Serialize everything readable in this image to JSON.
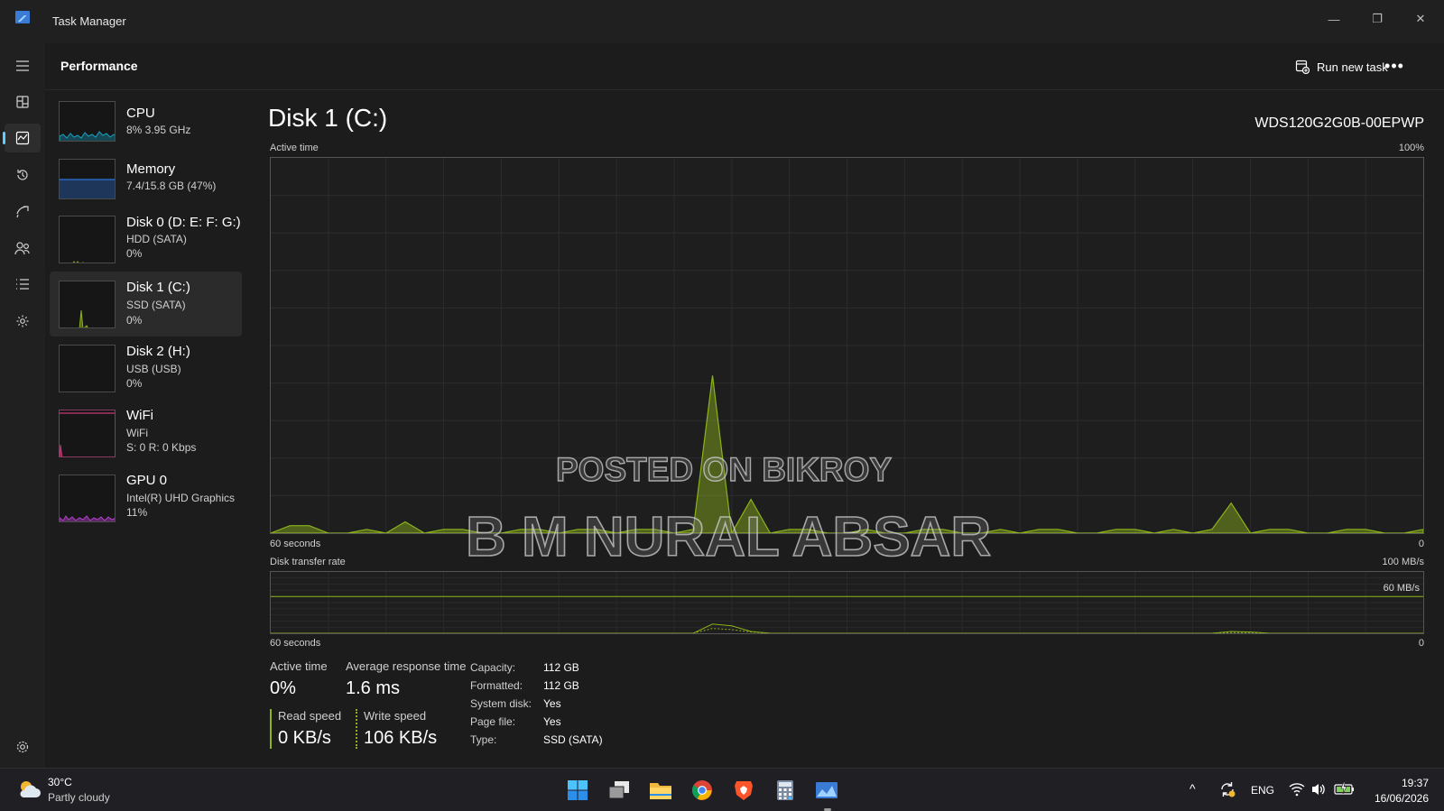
{
  "window": {
    "title": "Task Manager",
    "minimize_glyph": "—",
    "restore_glyph": "❐",
    "close_glyph": "✕"
  },
  "nav": {
    "items": [
      {
        "icon": "hamburger-menu-icon",
        "label": "Menu"
      },
      {
        "icon": "processes-icon",
        "label": "Processes"
      },
      {
        "icon": "performance-icon",
        "label": "Performance",
        "active": true
      },
      {
        "icon": "app-history-icon",
        "label": "App history"
      },
      {
        "icon": "startup-apps-icon",
        "label": "Startup apps"
      },
      {
        "icon": "users-icon",
        "label": "Users"
      },
      {
        "icon": "details-icon",
        "label": "Details"
      },
      {
        "icon": "services-icon",
        "label": "Services"
      }
    ],
    "settings_icon": "gear-icon"
  },
  "header": {
    "title": "Performance",
    "run_new_task": "Run new task",
    "more_glyph": "•••"
  },
  "devices": [
    {
      "name": "CPU",
      "sub1": "8% 3.95 GHz",
      "sub2": "",
      "color": "#17a2c4"
    },
    {
      "name": "Memory",
      "sub1": "7.4/15.8 GB (47%)",
      "sub2": "",
      "color": "#2d74d9"
    },
    {
      "name": "Disk 0 (D: E: F: G:)",
      "sub1": "HDD (SATA)",
      "sub2": "0%",
      "color": "#8cb31a"
    },
    {
      "name": "Disk 1 (C:)",
      "sub1": "SSD (SATA)",
      "sub2": "0%",
      "color": "#8cb31a",
      "selected": true
    },
    {
      "name": "Disk 2 (H:)",
      "sub1": "USB (USB)",
      "sub2": "0%",
      "color": "#8cb31a"
    },
    {
      "name": "WiFi",
      "sub1": "WiFi",
      "sub2": "S: 0 R: 0 Kbps",
      "color": "#c23a7a"
    },
    {
      "name": "GPU 0",
      "sub1": "Intel(R) UHD Graphics",
      "sub2": "11%",
      "color": "#b13fc8"
    }
  ],
  "main": {
    "title": "Disk 1 (C:)",
    "model": "WDS120G2G0B-00EPWP",
    "active_time_label": "Active time",
    "active_time_max": "100%",
    "active_time_left": "60 seconds",
    "active_time_right": "0",
    "transfer_label": "Disk transfer rate",
    "transfer_max": "100 MB/s",
    "transfer_line_label": "60 MB/s",
    "transfer_left": "60 seconds",
    "transfer_right": "0",
    "accent_color": "#8cb31a"
  },
  "chart_data": [
    {
      "type": "area",
      "title": "Active time",
      "x_range_label": "60 seconds",
      "ylim": [
        0,
        100
      ],
      "grid": true,
      "x": [
        0,
        1,
        2,
        3,
        4,
        5,
        6,
        7,
        8,
        9,
        10,
        11,
        12,
        13,
        14,
        15,
        16,
        17,
        18,
        19,
        20,
        21,
        22,
        23,
        24,
        25,
        26,
        27,
        28,
        29,
        30,
        31,
        32,
        33,
        34,
        35,
        36,
        37,
        38,
        39,
        40,
        41,
        42,
        43,
        44,
        45,
        46,
        47,
        48,
        49,
        50,
        51,
        52,
        53,
        54,
        55,
        56,
        57,
        58,
        59,
        60
      ],
      "values": [
        0,
        2,
        2,
        0,
        0,
        1,
        0,
        3,
        0,
        1,
        1,
        0,
        0,
        1,
        1,
        0,
        1,
        1,
        0,
        1,
        1,
        0,
        1,
        42,
        0,
        9,
        0,
        1,
        1,
        0,
        0,
        1,
        0,
        0,
        1,
        1,
        0,
        0,
        1,
        0,
        1,
        1,
        0,
        0,
        1,
        1,
        0,
        1,
        0,
        1,
        8,
        0,
        1,
        1,
        0,
        0,
        1,
        1,
        0,
        0,
        1
      ]
    },
    {
      "type": "line",
      "title": "Disk transfer rate",
      "x_range_label": "60 seconds",
      "ylim": [
        0,
        100
      ],
      "reference_line": 60,
      "grid": true,
      "series": [
        {
          "name": "Read speed",
          "values": [
            0,
            0,
            0,
            0,
            0,
            0,
            0,
            0,
            0,
            0,
            0,
            0,
            0,
            0,
            0,
            0,
            0,
            0,
            0,
            0,
            0,
            0,
            0,
            15,
            12,
            3,
            0,
            0,
            0,
            0,
            0,
            0,
            0,
            0,
            0,
            0,
            0,
            0,
            0,
            0,
            0,
            0,
            0,
            0,
            0,
            0,
            0,
            0,
            0,
            0,
            3,
            2,
            0,
            0,
            0,
            0,
            0,
            0,
            0,
            0,
            0
          ]
        },
        {
          "name": "Write speed",
          "values": [
            0,
            0,
            0,
            0,
            0,
            0,
            0,
            0,
            0,
            0,
            0,
            0,
            0,
            0,
            0,
            0,
            0,
            0,
            0,
            0,
            0,
            0,
            0,
            8,
            6,
            2,
            0,
            0,
            0,
            0,
            0,
            0,
            0,
            0,
            0,
            0,
            0,
            0,
            0,
            0,
            0,
            0,
            0,
            0,
            0,
            0,
            0,
            0,
            0,
            0,
            1,
            1,
            0,
            0,
            0,
            0,
            0,
            0,
            0,
            0,
            0
          ]
        }
      ]
    }
  ],
  "stats": {
    "active_time_label": "Active time",
    "active_time_value": "0%",
    "avg_response_label": "Average response time",
    "avg_response_value": "1.6 ms",
    "read_label": "Read speed",
    "read_value": "0 KB/s",
    "write_label": "Write speed",
    "write_value": "106 KB/s",
    "props": [
      {
        "key": "Capacity:",
        "value": "112 GB"
      },
      {
        "key": "Formatted:",
        "value": "112 GB"
      },
      {
        "key": "System disk:",
        "value": "Yes"
      },
      {
        "key": "Page file:",
        "value": "Yes"
      },
      {
        "key": "Type:",
        "value": "SSD (SATA)"
      }
    ]
  },
  "watermark": {
    "line1": "POSTED ON BIKROY",
    "line2": "B M NURAL ABSAR"
  },
  "taskbar": {
    "weather_temp": "30°C",
    "weather_desc": "Partly cloudy",
    "apps": [
      "start-icon",
      "task-view-icon",
      "file-explorer-icon",
      "chrome-icon",
      "brave-icon",
      "calculator-icon",
      "task-manager-icon"
    ],
    "chevron": "^",
    "language": "ENG",
    "time": "19:37",
    "date": "16/06/2026"
  }
}
